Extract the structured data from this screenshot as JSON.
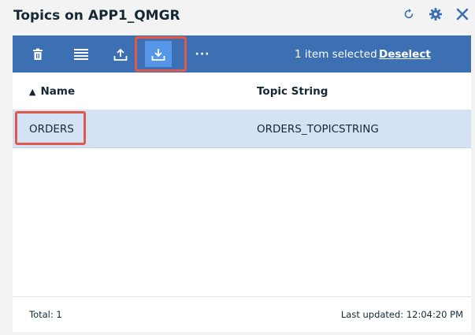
{
  "header": {
    "title": "Topics on APP1_QMGR",
    "icons": [
      "refresh-icon",
      "gear-icon",
      "close-icon"
    ],
    "accent_color": "#3d70b2"
  },
  "toolbar": {
    "buttons": [
      "delete-icon",
      "properties-icon",
      "upload-icon",
      "download-icon",
      "more-icon"
    ],
    "more_label": "···",
    "selection_status": "1 item selected",
    "deselect_label": "Deselect",
    "highlight_color": "#e0594b"
  },
  "table": {
    "columns": [
      {
        "label": "Name",
        "sort": "▲"
      },
      {
        "label": "Topic String"
      }
    ],
    "rows": [
      {
        "name": "ORDERS",
        "topic_string": "ORDERS_TOPICSTRING",
        "selected": true
      }
    ]
  },
  "footer": {
    "total": "Total: 1",
    "last_updated": "Last updated: 12:04:20 PM"
  }
}
